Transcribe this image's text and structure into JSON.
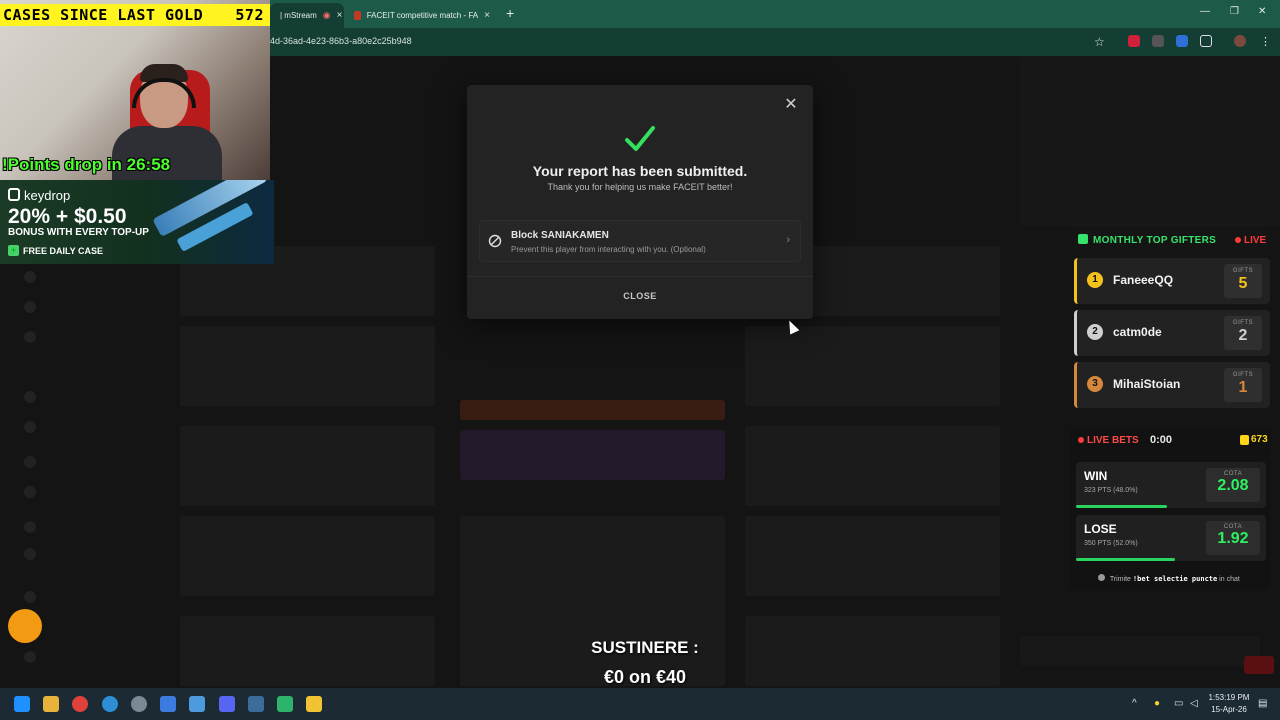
{
  "browser": {
    "tabs": [
      {
        "label": "| mStream"
      },
      {
        "label": "FACEIT competitive match - FA"
      }
    ],
    "url": "4d-36ad-4e23-86b3-a80e2c25b948"
  },
  "overlay": {
    "cases_label": "CASES SINCE LAST GOLD",
    "cases_count": "572",
    "points_drop": "!Points drop in 26:58",
    "ad": {
      "brand": "keydrop",
      "promo": "20% + $0.50",
      "sub": "BONUS WITH EVERY TOP-UP",
      "cta": "FREE DAILY CASE"
    },
    "sustinere_label": "SUSTINERE :",
    "sustinere_value": "€0 on €40"
  },
  "modal": {
    "title": "Your report has been submitted.",
    "subtitle": "Thank you for helping us make FACEIT better!",
    "block_title": "Block SANIAKAMEN",
    "block_desc": "Prevent this player from interacting with you. (Optional)",
    "close_label": "CLOSE"
  },
  "gifters": {
    "title": "MONTHLY TOP GIFTERS",
    "live": "LIVE",
    "gift_label": "GIFTS",
    "items": [
      {
        "rank": "1",
        "name": "FaneeeQQ",
        "count": "5",
        "color": "#f4c21a"
      },
      {
        "rank": "2",
        "name": "catm0de",
        "count": "2",
        "color": "#cfcfcf"
      },
      {
        "rank": "3",
        "name": "MihaiStoian",
        "count": "1",
        "color": "#d5883c"
      }
    ]
  },
  "bets": {
    "title": "LIVE BETS",
    "timer": "0:00",
    "points": "673",
    "cota_label": "COTA",
    "options": [
      {
        "name": "WIN",
        "sub": "323 PTS (48.0%)",
        "cota": "2.08",
        "share": 48.0
      },
      {
        "name": "LOSE",
        "sub": "350 PTS (52.0%)",
        "cota": "1.92",
        "share": 52.0
      }
    ],
    "hint_pre": "Trimite",
    "hint_cmd": "!bet selectie puncte",
    "hint_post": "in chat"
  },
  "taskbar": {
    "time": "1:53:19 PM",
    "date": "15-Apr-26"
  },
  "colors": {
    "accent_green": "#36e36b",
    "live_red": "#ff3b3b",
    "highlight_yellow": "#fff41f"
  }
}
